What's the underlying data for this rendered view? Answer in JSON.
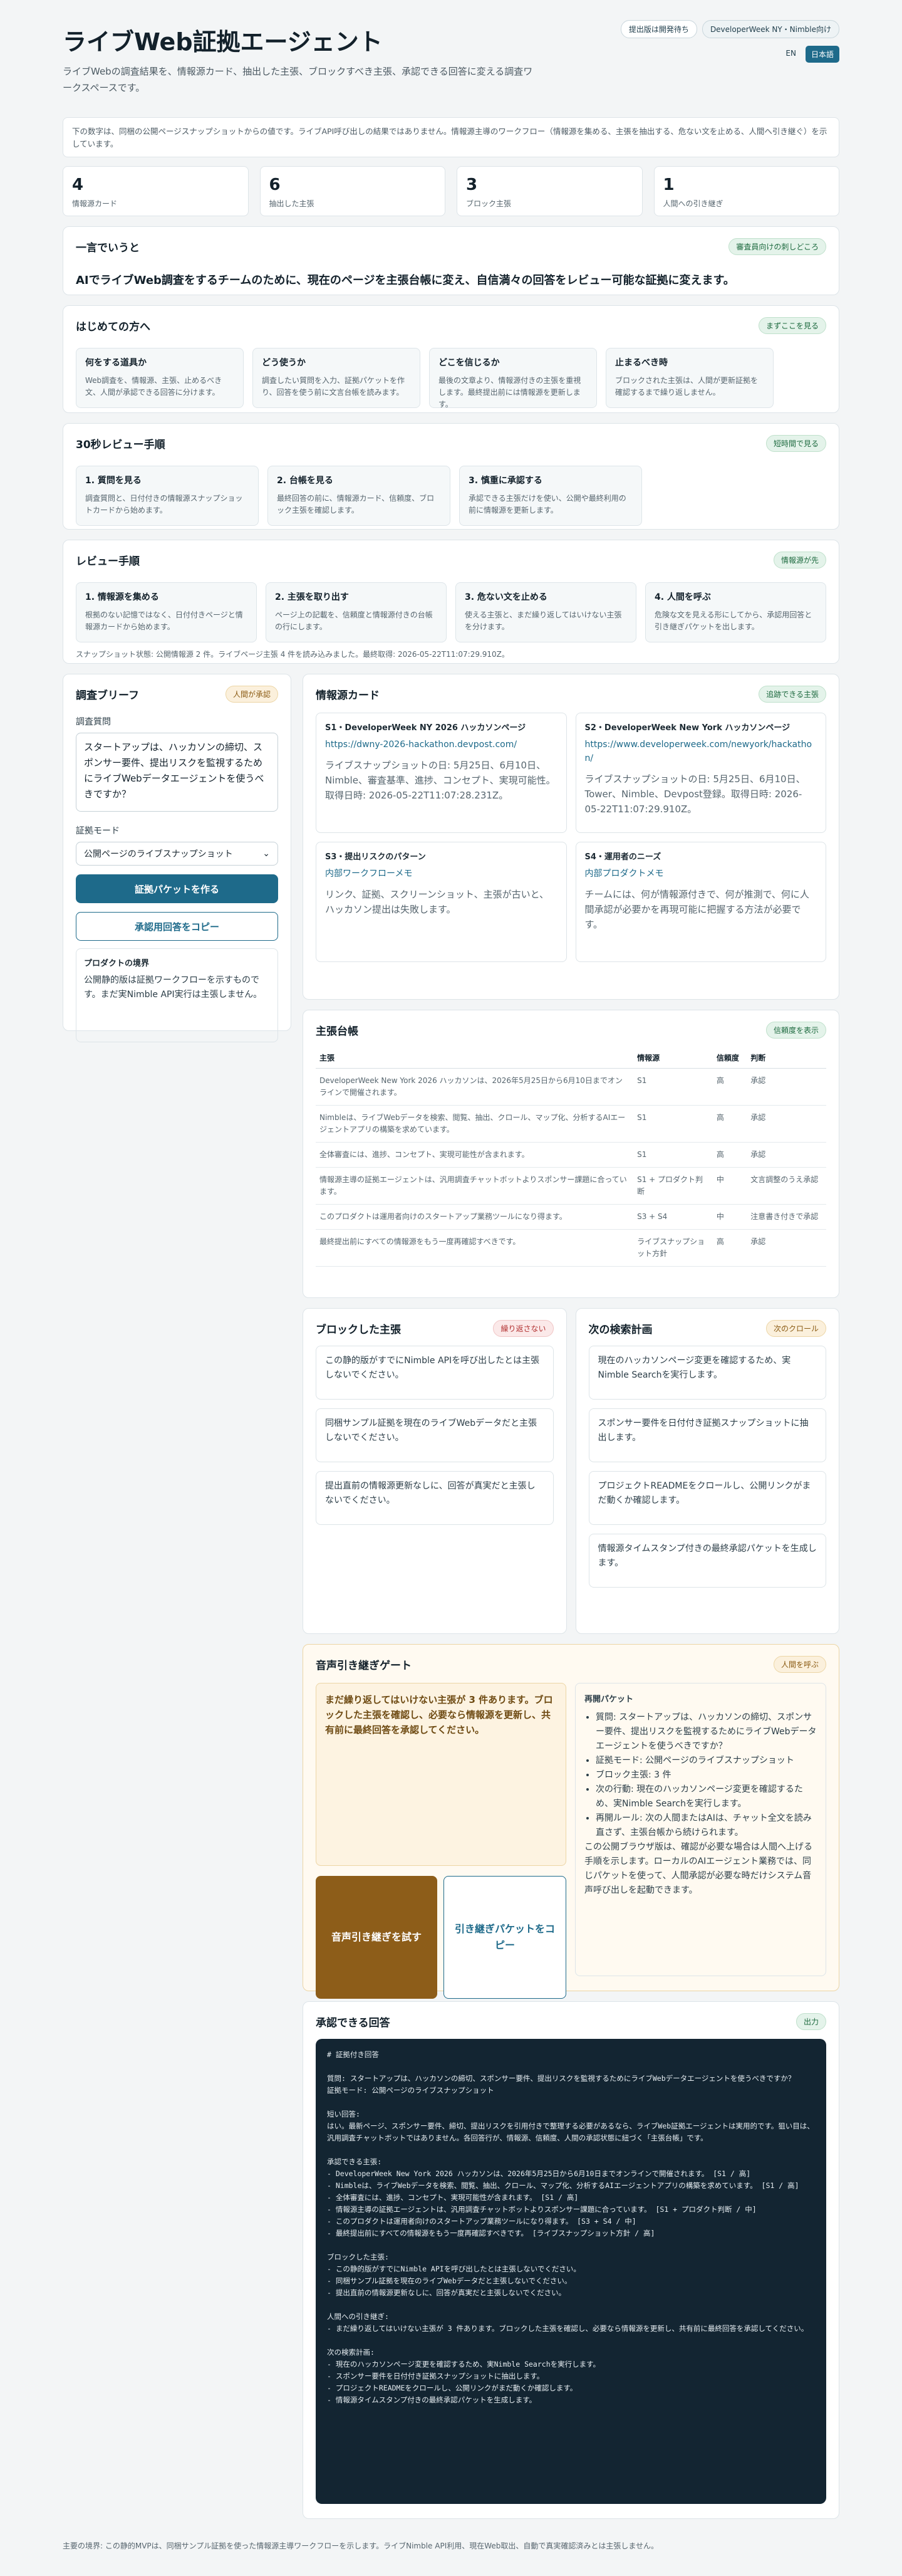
{
  "header": {
    "title": "ライブWeb証拠エージェント",
    "subtitle": "ライブWebの調査結果を、情報源カード、抽出した主張、ブロックすべき主張、承認できる回答に変える調査ワークスペースです。",
    "pill_pending": "提出版は開発待ち",
    "pill_event": "DeveloperWeek NY・Nimble向け",
    "lang_en": "EN",
    "lang_ja": "日本語"
  },
  "notice": "下の数字は、同梱の公開ページスナップショットからの値です。ライブAPI呼び出しの結果ではありません。情報源主導のワークフロー（情報源を集める、主張を抽出する、危ない文を止める、人間へ引き継ぐ）を示しています。",
  "stats": [
    {
      "n": "4",
      "l": "情報源カード"
    },
    {
      "n": "6",
      "l": "抽出した主張"
    },
    {
      "n": "3",
      "l": "ブロック主張"
    },
    {
      "n": "1",
      "l": "人間への引き継ぎ"
    }
  ],
  "oneline": {
    "title": "一言でいうと",
    "tag": "審査員向けの刺しどころ",
    "text": "AIでライブWeb調査をするチームのために、現在のページを主張台帳に変え、自信満々の回答をレビュー可能な証拠に変えます。"
  },
  "first": {
    "title": "はじめての方へ",
    "tag": "まずここを見る",
    "tiles": [
      {
        "t": "何をする道具か",
        "d": "Web調査を、情報源、主張、止めるべき文、人間が承認できる回答に分けます。"
      },
      {
        "t": "どう使うか",
        "d": "調査したい質問を入力、証拠パケットを作り、回答を使う前に文言台帳を読みます。"
      },
      {
        "t": "どこを信じるか",
        "d": "最後の文章より、情報源付きの主張を重視します。最終提出前には情報源を更新します。"
      },
      {
        "t": "止まるべき時",
        "d": "ブロックされた主張は、人間が更新証拠を確認するまで繰り返しません。"
      }
    ]
  },
  "review30": {
    "title": "30秒レビュー手順",
    "tag": "短時間で見る",
    "tiles": [
      {
        "t": "1. 質問を見る",
        "d": "調査質問と、日付付きの情報源スナップショットカードから始めます。"
      },
      {
        "t": "2. 台帳を見る",
        "d": "最終回答の前に、情報源カード、信頼度、ブロック主張を確認します。"
      },
      {
        "t": "3. 慎重に承認する",
        "d": "承認できる主張だけを使い、公開や最終利用の前に情報源を更新します。"
      }
    ]
  },
  "review": {
    "title": "レビュー手順",
    "tag": "情報源が先",
    "tiles": [
      {
        "t": "1. 情報源を集める",
        "d": "根拠のない記憶ではなく、日付付きページと情報源カードから始めます。"
      },
      {
        "t": "2. 主張を取り出す",
        "d": "ページ上の記載を、信頼度と情報源付きの台帳の行にします。"
      },
      {
        "t": "3. 危ない文を止める",
        "d": "使える主張と、まだ繰り返してはいけない主張を分けます。"
      },
      {
        "t": "4. 人間を呼ぶ",
        "d": "危険な文を見える形にしてから、承認用回答と引き継ぎパケットを出します。"
      }
    ],
    "status": "スナップショット状態: 公開情報源 2 件。ライブページ主張 4 件を読み込みました。最終取得: 2026-05-22T11:07:29.910Z。"
  },
  "brief": {
    "title": "調査ブリーフ",
    "tag": "人間が承認",
    "q_label": "調査質問",
    "question": "スタートアップは、ハッカソンの締切、スポンサー要件、提出リスクを監視するためにライブWebデータエージェントを使うべきですか？",
    "mode_label": "証拠モード",
    "mode": "公開ページのライブスナップショット",
    "build": "証拠パケットを作る",
    "copy": "承認用回答をコピー",
    "bound_t": "プロダクトの境界",
    "bound_d": "公開静的版は証拠ワークフローを示すものです。まだ実Nimble API実行は主張しません。"
  },
  "cards": {
    "title": "情報源カード",
    "tag": "追跡できる主張",
    "items": [
      {
        "id": "S1・DeveloperWeek NY 2026 ハッカソンページ",
        "url": "https://dwny-2026-hackathon.devpost.com/",
        "x": "ライブスナップショットの日: 5月25日、6月10日、Nimble、審査基準、進捗、コンセプト、実現可能性。取得日時: 2026-05-22T11:07:28.231Z。"
      },
      {
        "id": "S2・DeveloperWeek New York ハッカソンページ",
        "url": "https://www.developerweek.com/newyork/hackathon/",
        "x": "ライブスナップショットの日: 5月25日、6月10日、Tower、Nimble、Devpost登録。取得日時: 2026-05-22T11:07:29.910Z。"
      },
      {
        "id": "S3・提出リスクのパターン",
        "url": "内部ワークフローメモ",
        "x": "リンク、証拠、スクリーンショット、主張が古いと、ハッカソン提出は失敗します。"
      },
      {
        "id": "S4・運用者のニーズ",
        "url": "内部プロダクトメモ",
        "x": "チームには、何が情報源付きで、何が推測で、何に人間承認が必要かを再現可能に把握する方法が必要です。"
      }
    ]
  },
  "ledger": {
    "title": "主張台帳",
    "tag": "信頼度を表示",
    "cols": [
      "主張",
      "情報源",
      "信頼度",
      "判断"
    ],
    "rows": [
      [
        "DeveloperWeek New York 2026 ハッカソンは、2026年5月25日から6月10日までオンラインで開催されます。",
        "S1",
        "高",
        "承認"
      ],
      [
        "Nimbleは、ライブWebデータを検索、閲覧、抽出、クロール、マップ化、分析するAIエージェントアプリの構築を求めています。",
        "S1",
        "高",
        "承認"
      ],
      [
        "全体審査には、進捗、コンセプト、実現可能性が含まれます。",
        "S1",
        "高",
        "承認"
      ],
      [
        "情報源主導の証拠エージェントは、汎用調査チャットボットよりスポンサー課題に合っています。",
        "S1 + プロダクト判断",
        "中",
        "文言調整のうえ承認"
      ],
      [
        "このプロダクトは運用者向けのスタートアップ業務ツールになり得ます。",
        "S3 + S4",
        "中",
        "注意書き付きで承認"
      ],
      [
        "最終提出前にすべての情報源をもう一度再確認すべきです。",
        "ライブスナップショット方針",
        "高",
        "承認"
      ]
    ]
  },
  "blocked": {
    "title": "ブロックした主張",
    "tag": "繰り返さない",
    "items": [
      "この静的版がすでにNimble APIを呼び出したとは主張しないでください。",
      "同梱サンプル証拠を現在のライブWebデータだと主張しないでください。",
      "提出直前の情報源更新なしに、回答が真実だと主張しないでください。"
    ]
  },
  "plan": {
    "title": "次の検索計画",
    "tag": "次のクロール",
    "items": [
      "現在のハッカソンページ変更を確認するため、実Nimble Searchを実行します。",
      "スポンサー要件を日付付き証拠スナップショットに抽出します。",
      "プロジェクトREADMEをクロールし、公開リンクがまだ動くか確認します。",
      "情報源タイムスタンプ付きの最終承認パケットを生成します。"
    ]
  },
  "voice": {
    "title": "音声引き継ぎゲート",
    "tag": "人間を呼ぶ",
    "warn": "まだ繰り返してはいけない主張が 3 件あります。ブロックした主張を確認し、必要なら情報源を更新し、共有前に最終回答を承認してください。",
    "try": "音声引き継ぎを試す",
    "copy": "引き継ぎパケットをコピー",
    "pack_t": "再開パケット",
    "pack": [
      "質問: スタートアップは、ハッカソンの締切、スポンサー要件、提出リスクを監視するためにライブWebデータエージェントを使うべきですか？",
      "証拠モード: 公開ページのライブスナップショット",
      "ブロック主張: 3 件",
      "次の行動: 現在のハッカソンページ変更を確認するため、実Nimble Searchを実行します。",
      "再開ルール: 次の人間またはAIは、チャット全文を読み直さず、主張台帳から続けられます。"
    ],
    "pack_tail": "この公開ブラウザ版は、確認が必要な場合は人間へ上げる手順を示します。ローカルのAIエージェント業務では、同じパケットを使って、人間承認が必要な時だけシステム音声呼び出しを起動できます。"
  },
  "answer": {
    "title": "承認できる回答",
    "tag": "出力",
    "text": "# 証拠付き回答\n\n質問: スタートアップは、ハッカソンの締切、スポンサー要件、提出リスクを監視するためにライブWebデータエージェントを使うべきですか？\n証拠モード: 公開ページのライブスナップショット\n\n短い回答:\nはい。最新ページ、スポンサー要件、締切、提出リスクを引用付きで整理する必要があるなら、ライブWeb証拠エージェントは実用的です。狙い目は、汎用調査チャットボットではありません。各回答行が、情報源、信頼度、人間の承認状態に紐づく「主張台帳」です。\n\n承認できる主張:\n- DeveloperWeek New York 2026 ハッカソンは、2026年5月25日から6月10日までオンラインで開催されます。 [S1 / 高]\n- Nimbleは、ライブWebデータを検索、閲覧、抽出、クロール、マップ化、分析するAIエージェントアプリの構築を求めています。 [S1 / 高]\n- 全体審査には、進捗、コンセプト、実現可能性が含まれます。 [S1 / 高]\n- 情報源主導の証拠エージェントは、汎用調査チャットボットよりスポンサー課題に合っています。 [S1 + プロダクト判断 / 中]\n- このプロダクトは運用者向けのスタートアップ業務ツールになり得ます。 [S3 + S4 / 中]\n- 最終提出前にすべての情報源をもう一度再確認すべきです。 [ライブスナップショット方針 / 高]\n\nブロックした主張:\n- この静的版がすでにNimble APIを呼び出したとは主張しないでください。\n- 同梱サンプル証拠を現在のライブWebデータだと主張しないでください。\n- 提出直前の情報源更新なしに、回答が真実だと主張しないでください。\n\n人間への引き継ぎ:\n- まだ繰り返してはいけない主張が 3 件あります。ブロックした主張を確認し、必要なら情報源を更新し、共有前に最終回答を承認してください。\n\n次の検索計画:\n- 現在のハッカソンページ変更を確認するため、実Nimble Searchを実行します。\n- スポンサー要件を日付付き証拠スナップショットに抽出します。\n- プロジェクトREADMEをクロールし、公開リンクがまだ動くか確認します。\n- 情報源タイムスタンプ付きの最終承認パケットを生成します。"
  },
  "footer": "主要の境界: この静的MVPは、同梱サンプル証拠を使った情報源主導ワークフローを示します。ライブNimble API利用、現在Web取出、自動で真実確認済みとは主張しません。"
}
